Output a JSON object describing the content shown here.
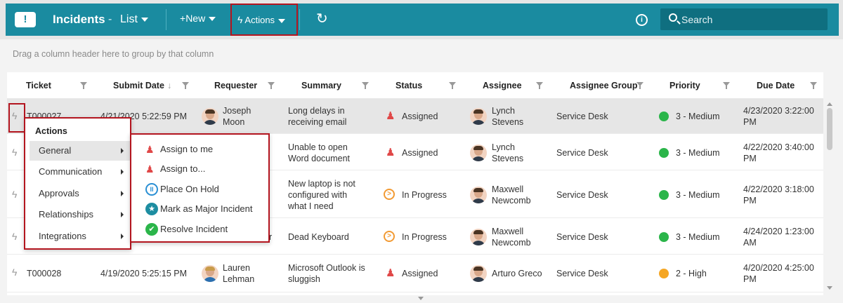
{
  "header": {
    "logo": "!",
    "title": "Incidents",
    "separator": "-",
    "view": "List",
    "new_label": "New",
    "actions_label": "Actions",
    "search_placeholder": "Search"
  },
  "group_hint": "Drag a column header here to group by that column",
  "columns": [
    "Ticket",
    "Submit Date",
    "Requester",
    "Summary",
    "Status",
    "Assignee",
    "Assignee Group",
    "Priority",
    "Due Date"
  ],
  "rows": [
    {
      "ticket": "T000027",
      "submit_date": "4/21/2020 5:22:59 PM",
      "requester": [
        "Joseph",
        "Moon"
      ],
      "summary": [
        "Long delays in",
        "receiving email"
      ],
      "status": "Assigned",
      "assignee": [
        "Lynch",
        "Stevens"
      ],
      "group": "Service Desk",
      "priority": "3 - Medium",
      "priority_color": "#2bb54a",
      "due": [
        "4/23/2020 3:22:00",
        "PM"
      ]
    },
    {
      "ticket": "",
      "submit_date": "",
      "requester": [
        "",
        ""
      ],
      "summary": [
        "Unable to open",
        "Word document"
      ],
      "status": "Assigned",
      "assignee": [
        "Lynch",
        "Stevens"
      ],
      "group": "Service Desk",
      "priority": "3 - Medium",
      "priority_color": "#2bb54a",
      "due": [
        "4/22/2020 3:40:00",
        "PM"
      ]
    },
    {
      "ticket": "",
      "submit_date": "",
      "requester": [
        "",
        ""
      ],
      "summary": [
        "New laptop is not",
        "configured with",
        "what I need"
      ],
      "status": "In Progress",
      "assignee": [
        "Maxwell",
        "Newcomb"
      ],
      "group": "Service Desk",
      "priority": "3 - Medium",
      "priority_color": "#2bb54a",
      "due": [
        "4/22/2020 3:18:00",
        "PM"
      ]
    },
    {
      "ticket": "",
      "submit_date": "",
      "requester": [
        "",
        "r"
      ],
      "summary": [
        "Dead Keyboard"
      ],
      "status": "In Progress",
      "assignee": [
        "Maxwell",
        "Newcomb"
      ],
      "group": "Service Desk",
      "priority": "3 - Medium",
      "priority_color": "#2bb54a",
      "due": [
        "4/24/2020 1:23:00",
        "AM"
      ]
    },
    {
      "ticket": "T000028",
      "submit_date": "4/19/2020 5:25:15 PM",
      "requester": [
        "Lauren",
        "Lehman"
      ],
      "summary": [
        "Microsoft Outlook is",
        "sluggish"
      ],
      "status": "Assigned",
      "assignee": [
        "Arturo Greco"
      ],
      "group": "Service Desk",
      "priority": "2 - High",
      "priority_color": "#f5a623",
      "due": [
        "4/20/2020 4:25:00",
        "PM"
      ]
    }
  ],
  "actions_menu": {
    "title": "Actions",
    "items": [
      "General",
      "Communication",
      "Approvals",
      "Relationships",
      "Integrations"
    ]
  },
  "general_submenu": {
    "items": [
      "Assign to me",
      "Assign to...",
      "Place On Hold",
      "Mark as Major Incident",
      "Resolve Incident"
    ]
  },
  "icons": {
    "logo": "ticket-icon",
    "actions": "bolt-icon",
    "refresh": "refresh-icon",
    "info": "info-icon",
    "search": "search-icon"
  },
  "colors": {
    "header_bg": "#1a8ba0",
    "highlight_border": "#b3151f",
    "assigned_icon": "#e04848",
    "in_progress_icon": "#f29a33",
    "medium_priority": "#2bb54a",
    "high_priority": "#f5a623"
  }
}
